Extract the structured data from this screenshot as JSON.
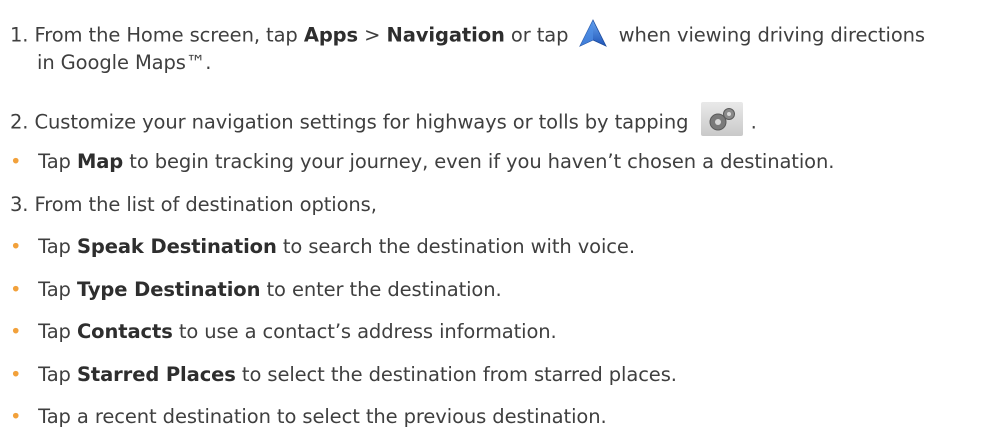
{
  "steps": {
    "s1": {
      "number": "1.",
      "prefix": "From the Home screen, tap",
      "bold1": "Apps",
      "sep": ">",
      "bold2": "Navigation",
      "middle": "or tap",
      "suffix": "when viewing driving directions",
      "line2": "in Google Maps™."
    },
    "s2": {
      "number": "2.",
      "text": "Customize your navigation settings for highways or tolls by tapping",
      "end": "."
    },
    "b1": {
      "bullet": "•",
      "pre": "Tap",
      "bold": "Map",
      "post": "to begin tracking your journey, even if you haven’t chosen a destination."
    },
    "s3": {
      "number": "3.",
      "text": "From the list of destination options,"
    },
    "b2": {
      "bullet": "•",
      "pre": "Tap",
      "bold": "Speak Destination",
      "post": "to search the destination with voice."
    },
    "b3": {
      "bullet": "•",
      "pre": "Tap",
      "bold": "Type Destination",
      "post": "to enter the destination."
    },
    "b4": {
      "bullet": "•",
      "pre": "Tap",
      "bold": "Contacts",
      "post": "to use a contact’s address information."
    },
    "b5": {
      "bullet": "•",
      "pre": "Tap",
      "bold": "Starred Places",
      "post": "to select the destination from starred places."
    },
    "b6": {
      "bullet": "•",
      "text": "Tap a recent destination to select the previous destination."
    }
  },
  "icons": {
    "navigation": "navigation-arrow-icon",
    "settings": "settings-gear-icon"
  },
  "colors": {
    "text": "#3f3f3f",
    "bullet": "#f2a13b",
    "nav_icon": "#2f6fd6"
  }
}
